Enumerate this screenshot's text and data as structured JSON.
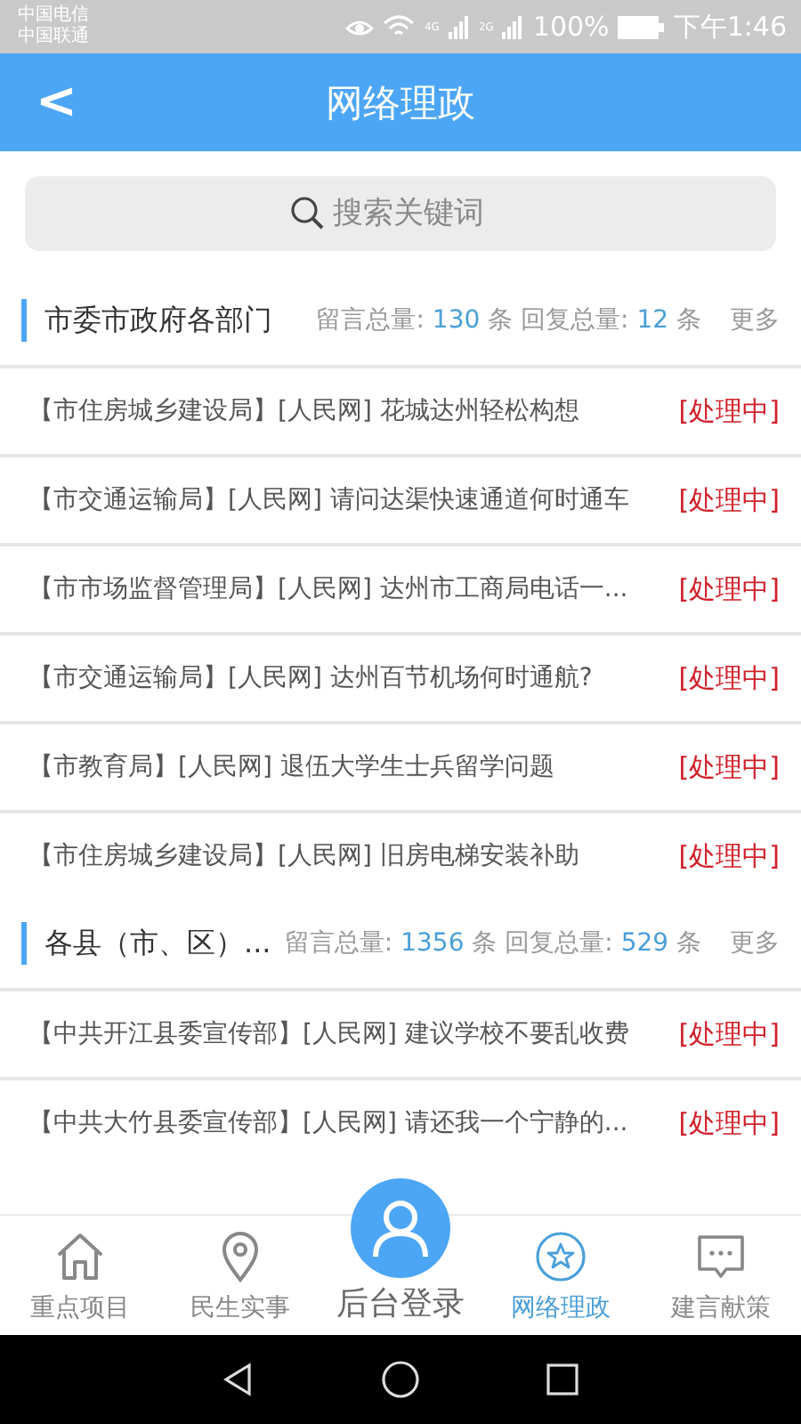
{
  "status_bar": {
    "carriers": [
      "中国电信",
      "中国联通"
    ],
    "network_labels": [
      "4G",
      "2G"
    ],
    "battery": "100%",
    "time": "下午1:46"
  },
  "header": {
    "back": "<",
    "title": "网络理政"
  },
  "search": {
    "placeholder": "搜索关键词"
  },
  "sections": [
    {
      "title": "市委市政府各部门",
      "count_label": "留言总量:",
      "count": "130",
      "count_unit": "条",
      "reply_label": "回复总量:",
      "reply": "12",
      "reply_unit": "条",
      "more": "更多",
      "rows": [
        {
          "text": "【市住房城乡建设局】[人民网] 花城达州轻松构想",
          "status": "[处理中]"
        },
        {
          "text": "【市交通运输局】[人民网] 请问达渠快速通道何时通车",
          "status": "[处理中]"
        },
        {
          "text": "【市市场监督管理局】[人民网] 达州市工商局电话一...",
          "status": "[处理中]"
        },
        {
          "text": "【市交通运输局】[人民网] 达州百节机场何时通航?",
          "status": "[处理中]"
        },
        {
          "text": "【市教育局】[人民网] 退伍大学生士兵留学问题",
          "status": "[处理中]"
        },
        {
          "text": "【市住房城乡建设局】[人民网] 旧房电梯安装补助",
          "status": "[处理中]"
        }
      ]
    },
    {
      "title": "各县（市、区）...",
      "count_label": "留言总量:",
      "count": "1356",
      "count_unit": "条",
      "reply_label": "回复总量:",
      "reply": "529",
      "reply_unit": "条",
      "more": "更多",
      "rows": [
        {
          "text": "【中共开江县委宣传部】[人民网] 建议学校不要乱收费",
          "status": "[处理中]"
        },
        {
          "text": "【中共大竹县委宣传部】[人民网] 请还我一个宁静的...",
          "status": "[处理中]"
        }
      ]
    }
  ],
  "tabs": [
    {
      "label": "重点项目",
      "kind": "normal",
      "selected": false
    },
    {
      "label": "民生实事",
      "kind": "normal",
      "selected": false
    },
    {
      "label": "后台登录",
      "kind": "raised",
      "selected": false
    },
    {
      "label": "网络理政",
      "kind": "normal",
      "selected": true
    },
    {
      "label": "建言献策",
      "kind": "normal",
      "selected": false
    }
  ]
}
